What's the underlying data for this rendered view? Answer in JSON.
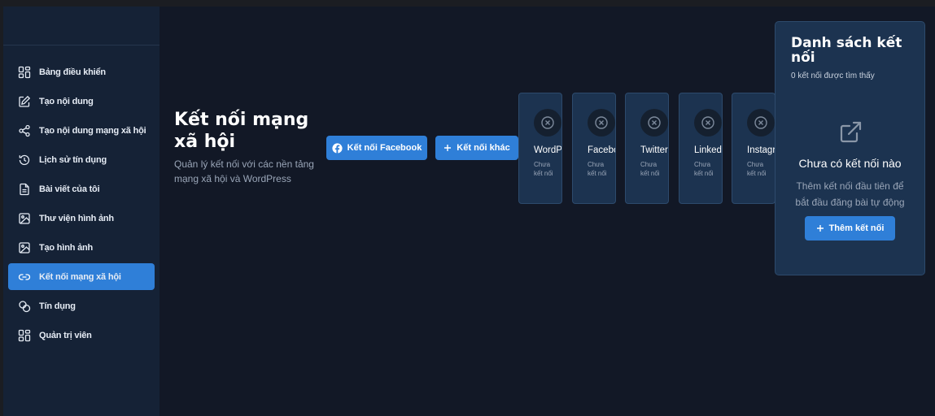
{
  "sidebar": {
    "items": [
      {
        "label": "Bảng điều khiển",
        "icon": "dashboard-icon"
      },
      {
        "label": "Tạo nội dung",
        "icon": "edit-icon"
      },
      {
        "label": "Tạo nội dung mạng xã hội",
        "icon": "share-icon"
      },
      {
        "label": "Lịch sử tín dụng",
        "icon": "history-icon"
      },
      {
        "label": "Bài viết của tôi",
        "icon": "document-icon"
      },
      {
        "label": "Thư viện hình ảnh",
        "icon": "image-icon"
      },
      {
        "label": "Tạo hình ảnh",
        "icon": "image-icon"
      },
      {
        "label": "Kết nối mạng xã hội",
        "icon": "link-icon",
        "active": true
      },
      {
        "label": "Tín dụng",
        "icon": "coins-icon"
      },
      {
        "label": "Quản trị viên",
        "icon": "dashboard-icon"
      }
    ]
  },
  "header": {
    "title": "Kết nối mạng xã hội",
    "subtitle": "Quản lý kết nối với các nền tảng mạng xã hội và WordPress"
  },
  "actions": {
    "connect_facebook": "Kết nối Facebook",
    "connect_other": "Kết nối khác"
  },
  "platforms": [
    {
      "name": "WordPress",
      "status": "Chưa kết nối"
    },
    {
      "name": "Facebook",
      "status": "Chưa kết nối"
    },
    {
      "name": "Twitter",
      "status": "Chưa kết nối"
    },
    {
      "name": "LinkedIn",
      "status": "Chưa kết nối"
    },
    {
      "name": "Instagram",
      "status": "Chưa kết nối"
    }
  ],
  "connections_panel": {
    "title": "Danh sách kết nối",
    "count_text": "0 kết nối được tìm thấy",
    "empty_title": "Chưa có kết nối nào",
    "empty_hint": "Thêm kết nối đầu tiên để bắt đầu đăng bài tự động",
    "add_button": "Thêm kết nối"
  },
  "colors": {
    "accent": "#2f7fd8",
    "background": "#121826",
    "sidebar": "#152236",
    "card": "#1c3350"
  }
}
